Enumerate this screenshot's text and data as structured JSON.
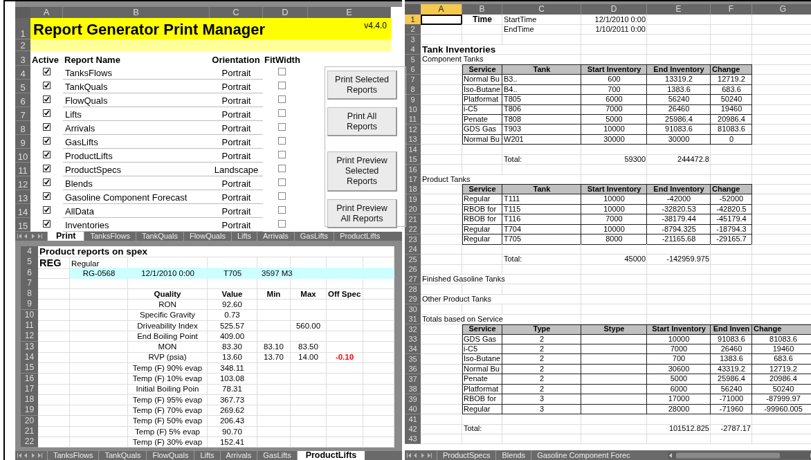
{
  "print_manager": {
    "columns": [
      "A",
      "B",
      "C",
      "D",
      "E"
    ],
    "row_numbers": [
      "1",
      "2",
      "3",
      "4",
      "5",
      "6",
      "7",
      "8",
      "9",
      "10",
      "11",
      "12",
      "13",
      "14",
      "15"
    ],
    "title": "Report Generator Print Manager",
    "version": "v4.4.0",
    "headers": [
      "Active",
      "Report Name",
      "Orientation",
      "FitWidth"
    ],
    "reports": [
      {
        "active": true,
        "name": "TanksFlows",
        "orientation": "Portrait",
        "fit_width": false
      },
      {
        "active": true,
        "name": "TankQuals",
        "orientation": "Portrait",
        "fit_width": false
      },
      {
        "active": true,
        "name": "FlowQuals",
        "orientation": "Portrait",
        "fit_width": false
      },
      {
        "active": true,
        "name": "Lifts",
        "orientation": "Portrait",
        "fit_width": false
      },
      {
        "active": true,
        "name": "Arrivals",
        "orientation": "Portrait",
        "fit_width": false
      },
      {
        "active": true,
        "name": "GasLifts",
        "orientation": "Portrait",
        "fit_width": false
      },
      {
        "active": true,
        "name": "ProductLifts",
        "orientation": "Portrait",
        "fit_width": false
      },
      {
        "active": true,
        "name": "ProductSpecs",
        "orientation": "Landscape",
        "fit_width": false
      },
      {
        "active": true,
        "name": "Blends",
        "orientation": "Portrait",
        "fit_width": false
      },
      {
        "active": true,
        "name": "Gasoline Component Forecast",
        "orientation": "Portrait",
        "fit_width": false
      },
      {
        "active": true,
        "name": "AllData",
        "orientation": "Portrait",
        "fit_width": false
      },
      {
        "active": true,
        "name": "Inventories",
        "orientation": "Portrait",
        "fit_width": false
      }
    ],
    "buttons": [
      {
        "lines": [
          "Print Selected",
          "Reports"
        ]
      },
      {
        "lines": [
          "Print All",
          "Reports"
        ]
      },
      {
        "lines": [
          "Print Preview",
          "Selected",
          "Reports"
        ]
      },
      {
        "lines": [
          "Print Preview",
          "All Reports"
        ]
      }
    ],
    "tabs": [
      {
        "label": "Print",
        "selected": true
      },
      {
        "label": "TanksFlows",
        "selected": false
      },
      {
        "label": "TankQuals",
        "selected": false
      },
      {
        "label": "FlowQuals",
        "selected": false
      },
      {
        "label": "Lifts",
        "selected": false
      },
      {
        "label": "Arrivals",
        "selected": false
      },
      {
        "label": "GasLifts",
        "selected": false
      },
      {
        "label": "ProductLifts",
        "selected": false
      }
    ]
  },
  "spec_report": {
    "row_numbers": [
      "4",
      "5",
      "6",
      "7",
      "8",
      "9",
      "10",
      "11",
      "12",
      "13",
      "14",
      "15",
      "16",
      "17",
      "18",
      "19",
      "20",
      "21",
      "22"
    ],
    "title": "Product reports on spex",
    "grade_code": "REG",
    "grade_name": "Regular",
    "batch": {
      "id": "RG-0568",
      "date": "12/1/2010 0:00",
      "tank": "T705",
      "volume": "3597 M3"
    },
    "headers": [
      "Quality",
      "Value",
      "Min",
      "Max",
      "Off Spec"
    ],
    "qualities": [
      {
        "name": "RON",
        "value": "92.60"
      },
      {
        "name": "Specific Gravity",
        "value": "0.73"
      },
      {
        "name": "Driveability Index",
        "value": "525.57",
        "max": "560.00"
      },
      {
        "name": "End Boiling Point",
        "value": "409.00"
      },
      {
        "name": "MON",
        "value": "83.30",
        "min": "83.10",
        "max": "83.50"
      },
      {
        "name": "RVP (psia)",
        "value": "13.60",
        "min": "13.70",
        "max": "14.00",
        "off_spec": "-0.10"
      },
      {
        "name": "Temp (F) 90% evap",
        "value": "348.11"
      },
      {
        "name": "Temp (F) 10% evap",
        "value": "103.08"
      },
      {
        "name": "Initial Boiling Poin",
        "value": "78.31"
      },
      {
        "name": "Temp (F) 95% evap",
        "value": "367.73"
      },
      {
        "name": "Temp (F) 70% evap",
        "value": "269.62"
      },
      {
        "name": "Temp (F) 50% evap",
        "value": "206.43"
      },
      {
        "name": "Temp (F) 5% evap",
        "value": "90.70"
      },
      {
        "name": "Temp (F) 30% evap",
        "value": "152.41"
      }
    ],
    "tabs": [
      {
        "label": "TanksFlows",
        "selected": false
      },
      {
        "label": "TankQuals",
        "selected": false
      },
      {
        "label": "FlowQuals",
        "selected": false
      },
      {
        "label": "Lifts",
        "selected": false
      },
      {
        "label": "Arrivals",
        "selected": false
      },
      {
        "label": "GasLifts",
        "selected": false
      },
      {
        "label": "ProductLifts",
        "selected": true
      }
    ]
  },
  "inventory": {
    "columns": [
      {
        "label": "A",
        "selected": true
      },
      {
        "label": "B",
        "selected": false
      },
      {
        "label": "C",
        "selected": false
      },
      {
        "label": "D",
        "selected": false
      },
      {
        "label": "E",
        "selected": false
      },
      {
        "label": "F",
        "selected": false
      },
      {
        "label": "G",
        "selected": false
      }
    ],
    "rows": [
      {
        "num": "1",
        "selected": true,
        "kind": "info",
        "B": "Time",
        "C": "StartTime",
        "D": "12/1/2010 0:00"
      },
      {
        "num": "2",
        "selected": false,
        "kind": "info",
        "C": "EndTime",
        "D": "1/10/2011 0:00"
      },
      {
        "num": "3",
        "selected": false,
        "kind": "blank"
      },
      {
        "num": "4",
        "selected": false,
        "kind": "title",
        "A": "Tank Inventories"
      },
      {
        "num": "5",
        "selected": false,
        "kind": "text",
        "A": "Component Tanks"
      },
      {
        "num": "6",
        "selected": false,
        "kind": "head",
        "wide": false,
        "B": "Service",
        "C": "Tank",
        "D": "Start Inventory",
        "E": "End Inventory",
        "F": "Change"
      },
      {
        "num": "7",
        "selected": false,
        "kind": "row",
        "wide": false,
        "B": "Normal Bu",
        "C": "B3..",
        "D": "600",
        "E": "13319.2",
        "F": "12719.2"
      },
      {
        "num": "8",
        "selected": false,
        "kind": "row",
        "wide": false,
        "B": "Iso-Butane",
        "C": "B4..",
        "D": "700",
        "E": "1383.6",
        "F": "683.6"
      },
      {
        "num": "9",
        "selected": false,
        "kind": "row",
        "wide": false,
        "B": "Platformat",
        "C": "T805",
        "D": "6000",
        "E": "56240",
        "F": "50240"
      },
      {
        "num": "10",
        "selected": false,
        "kind": "row",
        "wide": false,
        "B": "i-C5",
        "C": "T806",
        "D": "7000",
        "E": "26460",
        "F": "19460"
      },
      {
        "num": "11",
        "selected": false,
        "kind": "row",
        "wide": false,
        "B": "Penate",
        "C": "T808",
        "D": "5000",
        "E": "25986.4",
        "F": "20986.4"
      },
      {
        "num": "12",
        "selected": false,
        "kind": "row",
        "wide": false,
        "B": "GDS Gas",
        "C": "T903",
        "D": "10000",
        "E": "91083.6",
        "F": "81083.6"
      },
      {
        "num": "13",
        "selected": false,
        "kind": "row",
        "wide": false,
        "B": "Normal Bu",
        "C": "W201",
        "D": "30000",
        "E": "30000",
        "F": "0"
      },
      {
        "num": "14",
        "selected": false,
        "kind": "blank"
      },
      {
        "num": "15",
        "selected": false,
        "kind": "total",
        "C": "Total:",
        "D": "59300",
        "E": "244472.8"
      },
      {
        "num": "16",
        "selected": false,
        "kind": "blank"
      },
      {
        "num": "17",
        "selected": false,
        "kind": "text",
        "A": "Product Tanks"
      },
      {
        "num": "18",
        "selected": false,
        "kind": "head",
        "wide": false,
        "B": "Service",
        "C": "Tank",
        "D": "Start Inventory",
        "E": "End Inventory",
        "F": "Change"
      },
      {
        "num": "19",
        "selected": false,
        "kind": "row",
        "wide": false,
        "B": "Regular",
        "C": "T111",
        "D": "10000",
        "E": "-42000",
        "F": "-52000"
      },
      {
        "num": "20",
        "selected": false,
        "kind": "row",
        "wide": false,
        "B": "RBOB for",
        "C": "T115",
        "D": "10000",
        "E": "-32820.53",
        "F": "-42820.5"
      },
      {
        "num": "21",
        "selected": false,
        "kind": "row",
        "wide": false,
        "B": "RBOB for",
        "C": "T116",
        "D": "7000",
        "E": "-38179.44",
        "F": "-45179.4"
      },
      {
        "num": "22",
        "selected": false,
        "kind": "row",
        "wide": false,
        "B": "Regular",
        "C": "T704",
        "D": "10000",
        "E": "-8794.325",
        "F": "-18794.3"
      },
      {
        "num": "23",
        "selected": false,
        "kind": "row",
        "wide": false,
        "B": "Regular",
        "C": "T705",
        "D": "8000",
        "E": "-21165.68",
        "F": "-29165.7"
      },
      {
        "num": "24",
        "selected": false,
        "kind": "blank"
      },
      {
        "num": "25",
        "selected": false,
        "kind": "total",
        "C": "Total:",
        "D": "45000",
        "E": "-142959.975"
      },
      {
        "num": "26",
        "selected": false,
        "kind": "blank"
      },
      {
        "num": "27",
        "selected": false,
        "kind": "text",
        "A": "Finished Gasoline Tanks"
      },
      {
        "num": "28",
        "selected": false,
        "kind": "blank"
      },
      {
        "num": "29",
        "selected": false,
        "kind": "text",
        "A": "Other Product Tanks"
      },
      {
        "num": "30",
        "selected": false,
        "kind": "blank"
      },
      {
        "num": "31",
        "selected": false,
        "kind": "text",
        "A": "Totals based on Service"
      },
      {
        "num": "32",
        "selected": false,
        "kind": "head",
        "wide": true,
        "B": "Service",
        "C": "Type",
        "D": "Stype",
        "E": "Start Inventory",
        "F": "End Inven",
        "G": "Change"
      },
      {
        "num": "33",
        "selected": false,
        "kind": "row",
        "wide": true,
        "B": "GDS Gas",
        "C": "2",
        "E": "10000",
        "F": "91083.6",
        "G": "81083.6"
      },
      {
        "num": "34",
        "selected": false,
        "kind": "row",
        "wide": true,
        "B": "i-C5",
        "C": "2",
        "E": "7000",
        "F": "26460",
        "G": "19460"
      },
      {
        "num": "35",
        "selected": false,
        "kind": "row",
        "wide": true,
        "B": "Iso-Butane",
        "C": "2",
        "E": "700",
        "F": "1383.6",
        "G": "683.6"
      },
      {
        "num": "36",
        "selected": false,
        "kind": "row",
        "wide": true,
        "B": "Normal Bu",
        "C": "2",
        "E": "30600",
        "F": "43319.2",
        "G": "12719.2"
      },
      {
        "num": "37",
        "selected": false,
        "kind": "row",
        "wide": true,
        "B": "Penate",
        "C": "2",
        "E": "5000",
        "F": "25986.4",
        "G": "20986.4"
      },
      {
        "num": "38",
        "selected": false,
        "kind": "row",
        "wide": true,
        "B": "Platformat",
        "C": "2",
        "E": "6000",
        "F": "56240",
        "G": "50240"
      },
      {
        "num": "39",
        "selected": false,
        "kind": "row",
        "wide": true,
        "B": "RBOB for",
        "C": "3",
        "E": "17000",
        "F": "-71000",
        "G": "-87999.97"
      },
      {
        "num": "40",
        "selected": false,
        "kind": "row",
        "wide": true,
        "B": "Regular",
        "C": "3",
        "E": "28000",
        "F": "-71960",
        "G": "-99960.005"
      },
      {
        "num": "41",
        "selected": false,
        "kind": "blank"
      },
      {
        "num": "42",
        "selected": false,
        "kind": "total",
        "B": "Total:",
        "E": "101512.825",
        "F": "-2787.17"
      },
      {
        "num": "43",
        "selected": false,
        "kind": "blank"
      }
    ],
    "tabs": [
      {
        "label": "ProductSpecs",
        "selected": false
      },
      {
        "label": "Blends",
        "selected": false
      },
      {
        "label": "Gasoline Component Forec",
        "selected": false
      }
    ]
  }
}
